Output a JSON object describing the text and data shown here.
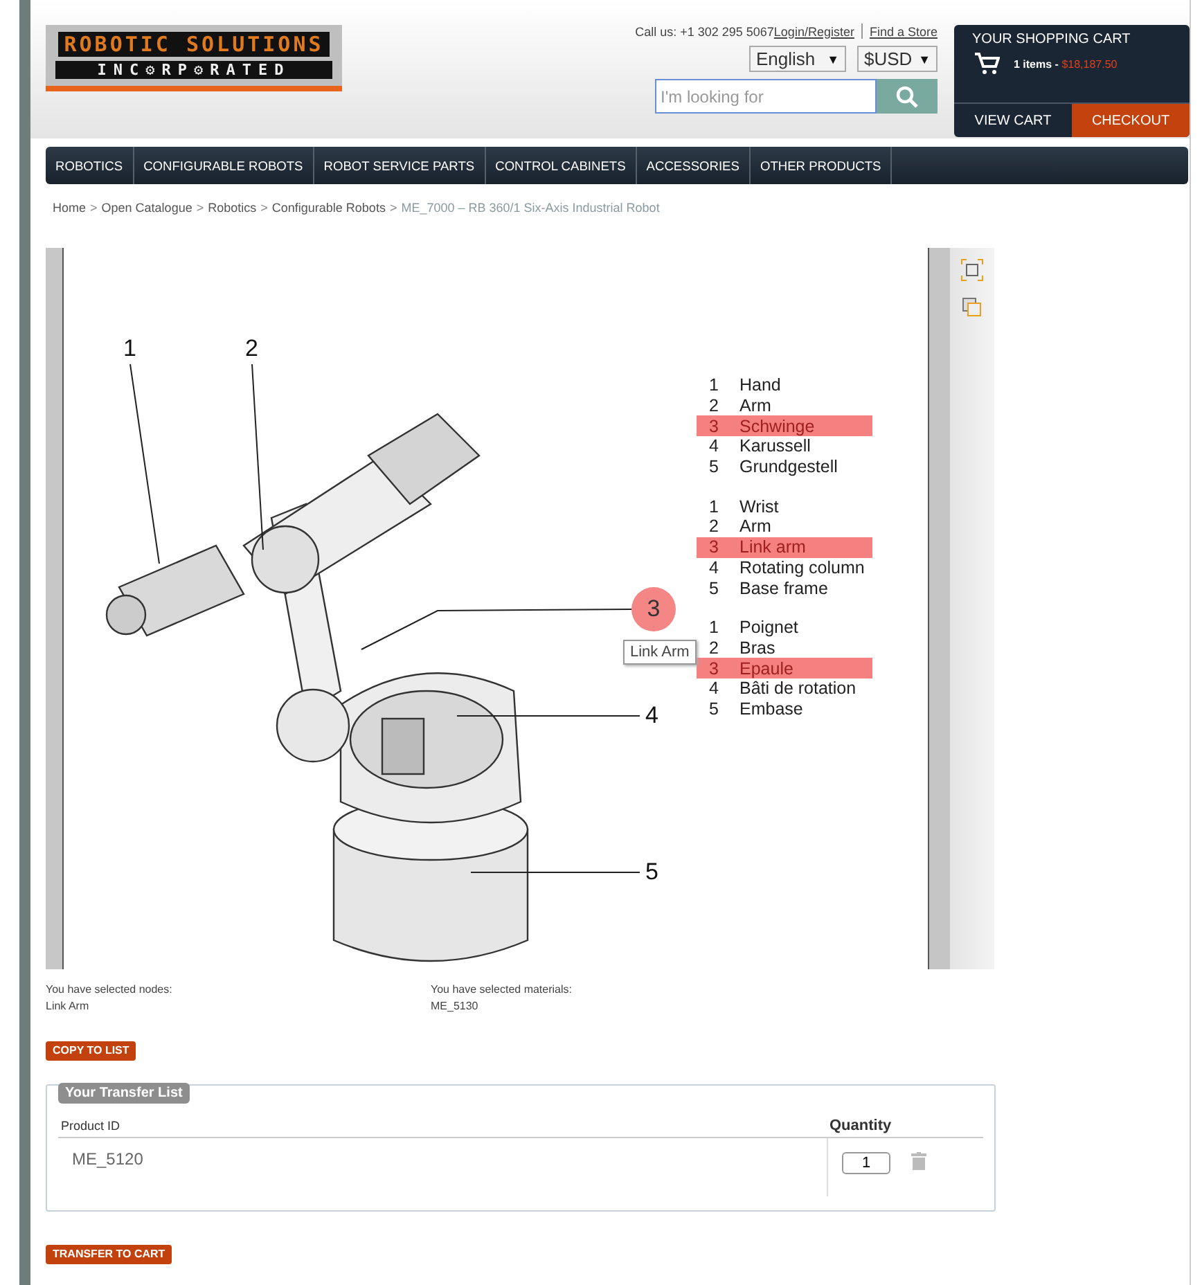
{
  "logo": {
    "line1": "ROBOTIC SOLUTIONS",
    "line2": "INC⚙RP⚙RATED"
  },
  "header": {
    "call_us": "Call us: +1 302 295 5067",
    "login": "Login/Register",
    "store": "Find a Store",
    "language": "English",
    "language_caret": "▼",
    "currency": "$USD",
    "currency_caret": "▼",
    "search": {
      "placeholder": "I'm looking for"
    }
  },
  "cart": {
    "title": "YOUR SHOPPING CART",
    "items": "1 items - ",
    "total": "$18,187.50",
    "view": "VIEW CART",
    "checkout": "CHECKOUT"
  },
  "nav": [
    "ROBOTICS",
    "CONFIGURABLE ROBOTS",
    "ROBOT SERVICE PARTS",
    "CONTROL CABINETS",
    "ACCESSORIES",
    "OTHER PRODUCTS"
  ],
  "breadcrumb": {
    "links": [
      "Home",
      "Open Catalogue",
      "Robotics",
      "Configurable Robots"
    ],
    "separator": ">",
    "current": "ME_7000 – RB 360/1 Six-Axis Industrial Robot"
  },
  "diagram": {
    "callouts": [
      "1",
      "2",
      "4",
      "5"
    ],
    "marker": "3",
    "tooltip": "Link Arm",
    "legend": [
      [
        {
          "num": "1",
          "label": "Hand",
          "selected": false
        },
        {
          "num": "2",
          "label": "Arm",
          "selected": false
        },
        {
          "num": "3",
          "label": "Schwinge",
          "selected": true
        },
        {
          "num": "4",
          "label": "Karussell",
          "selected": false
        },
        {
          "num": "5",
          "label": "Grundgestell",
          "selected": false
        }
      ],
      [
        {
          "num": "1",
          "label": "Wrist",
          "selected": false
        },
        {
          "num": "2",
          "label": "Arm",
          "selected": false
        },
        {
          "num": "3",
          "label": "Link arm",
          "selected": true
        },
        {
          "num": "4",
          "label": "Rotating column",
          "selected": false
        },
        {
          "num": "5",
          "label": "Base frame",
          "selected": false
        }
      ],
      [
        {
          "num": "1",
          "label": "Poignet",
          "selected": false
        },
        {
          "num": "2",
          "label": "Bras",
          "selected": false
        },
        {
          "num": "3",
          "label": "Epaule",
          "selected": true
        },
        {
          "num": "4",
          "label": "Bâti de rotation",
          "selected": false
        },
        {
          "num": "5",
          "label": "Embase",
          "selected": false
        }
      ]
    ]
  },
  "selection": {
    "nodes_label": "You have selected nodes:",
    "nodes": "Link Arm",
    "materials_label": "You have selected materials:",
    "materials": "ME_5130"
  },
  "copy_button": "COPY TO LIST",
  "transfer_list": {
    "title": "Your Transfer List",
    "columns": [
      "Product ID",
      "Quantity"
    ],
    "rows": [
      {
        "product_id": "ME_5120",
        "quantity": "1"
      }
    ]
  },
  "transfer_button": "TRANSFER TO CART"
}
